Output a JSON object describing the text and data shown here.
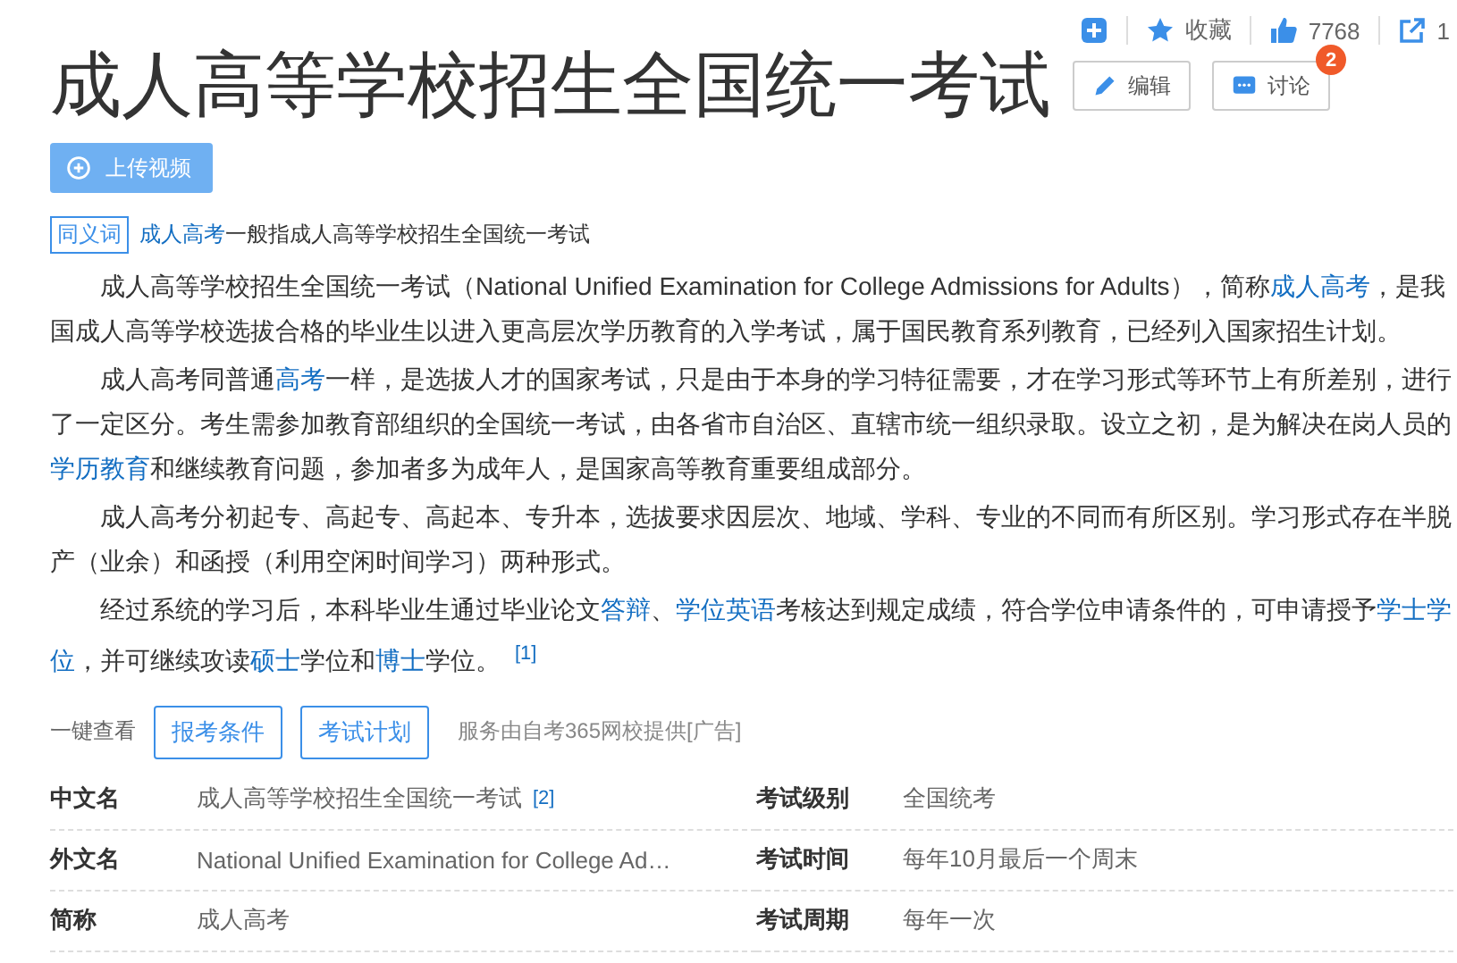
{
  "toolbar": [
    {
      "kind": "add"
    },
    {
      "kind": "star",
      "label": "收藏"
    },
    {
      "kind": "like",
      "label": "7768"
    },
    {
      "kind": "share",
      "label": "1"
    }
  ],
  "title": "成人高等学校招生全国统一考试",
  "title_buttons": [
    {
      "kind": "edit",
      "label": "编辑"
    },
    {
      "kind": "discuss",
      "label": "讨论",
      "badge": "2"
    }
  ],
  "upload_button": "上传视频",
  "synonym": {
    "tag": "同义词",
    "link": "成人高考",
    "text": "一般指成人高等学校招生全国统一考试"
  },
  "paragraphs": [
    [
      {
        "kind": "text",
        "text": "成人高等学校招生全国统一考试（National Unified Examination for College Admissions for Adults），简称"
      },
      {
        "kind": "link",
        "text": "成人高考"
      },
      {
        "kind": "text",
        "text": "，是我国成人高等学校选拔合格的毕业生以进入更高层次学历教育的入学考试，属于国民教育系列教育，已经列入国家招生计划。"
      }
    ],
    [
      {
        "kind": "text",
        "text": "成人高考同普通"
      },
      {
        "kind": "link",
        "text": "高考"
      },
      {
        "kind": "text",
        "text": "一样，是选拔人才的国家考试，只是由于本身的学习特征需要，才在学习形式等环节上有所差别，进行了一定区分。考生需参加教育部组织的全国统一考试，由各省市自治区、直辖市统一组织录取。设立之初，是为解决在岗人员的"
      },
      {
        "kind": "link",
        "text": "学历教育"
      },
      {
        "kind": "text",
        "text": "和继续教育问题，参加者多为成年人，是国家高等教育重要组成部分。"
      }
    ],
    [
      {
        "kind": "text",
        "text": "成人高考分初起专、高起专、高起本、专升本，选拔要求因层次、地域、学科、专业的不同而有所区别。学习形式存在半脱产（业余）和函授（利用空闲时间学习）两种形式。"
      }
    ],
    [
      {
        "kind": "text",
        "text": "经过系统的学习后，本科毕业生通过毕业论文"
      },
      {
        "kind": "link",
        "text": "答辩"
      },
      {
        "kind": "text",
        "text": "、"
      },
      {
        "kind": "link",
        "text": "学位英语"
      },
      {
        "kind": "text",
        "text": "考核达到规定成绩，符合学位申请条件的，可申请授予"
      },
      {
        "kind": "link",
        "text": "学士学"
      },
      {
        "kind": "link",
        "text": "位"
      },
      {
        "kind": "text",
        "text": "，并可继续攻读"
      },
      {
        "kind": "link",
        "text": "硕士"
      },
      {
        "kind": "text",
        "text": "学位和"
      },
      {
        "kind": "link",
        "text": "博士"
      },
      {
        "kind": "text",
        "text": "学位。"
      },
      {
        "kind": "ref",
        "text": "[1]"
      }
    ]
  ],
  "quick_view": {
    "label": "一键查看",
    "buttons": [
      "报考条件",
      "考试计划"
    ],
    "note": "服务由自考365网校提供[广告]"
  },
  "info": [
    {
      "label": "中文名",
      "value": "成人高等学校招生全国统一考试",
      "ref": "[2]"
    },
    {
      "label": "考试级别",
      "value": "全国统考"
    },
    {
      "label": "外文名",
      "value": "National Unified Examination for College Ad…"
    },
    {
      "label": "考试时间",
      "value": "每年10月最后一个周末"
    },
    {
      "label": "简称",
      "value": "成人高考"
    },
    {
      "label": "考试周期",
      "value": "每年一次"
    }
  ]
}
